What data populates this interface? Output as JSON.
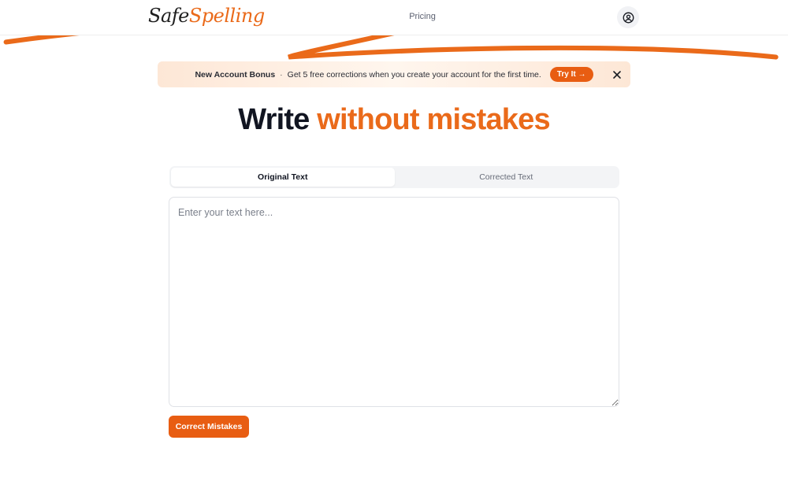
{
  "header": {
    "logo_part1": "Safe",
    "logo_part2": "Spelling",
    "nav_pricing": "Pricing",
    "user_icon": "user-circle-icon"
  },
  "banner": {
    "title": "New Account Bonus",
    "separator": "·",
    "message": "Get 5 free corrections when you create your account for the first time.",
    "cta_label": "Try It →",
    "close_icon": "close-icon"
  },
  "hero": {
    "word1": "Write",
    "word2": "without mistakes"
  },
  "tabs": [
    {
      "label": "Original Text",
      "active": true
    },
    {
      "label": "Corrected Text",
      "active": false
    }
  ],
  "editor": {
    "placeholder": "Enter your text here...",
    "value": ""
  },
  "actions": {
    "correct_label": "Correct Mistakes"
  },
  "colors": {
    "accent": "#e85d12",
    "accent_text": "#ea6a1a",
    "banner_bg": "#fde7d6"
  }
}
